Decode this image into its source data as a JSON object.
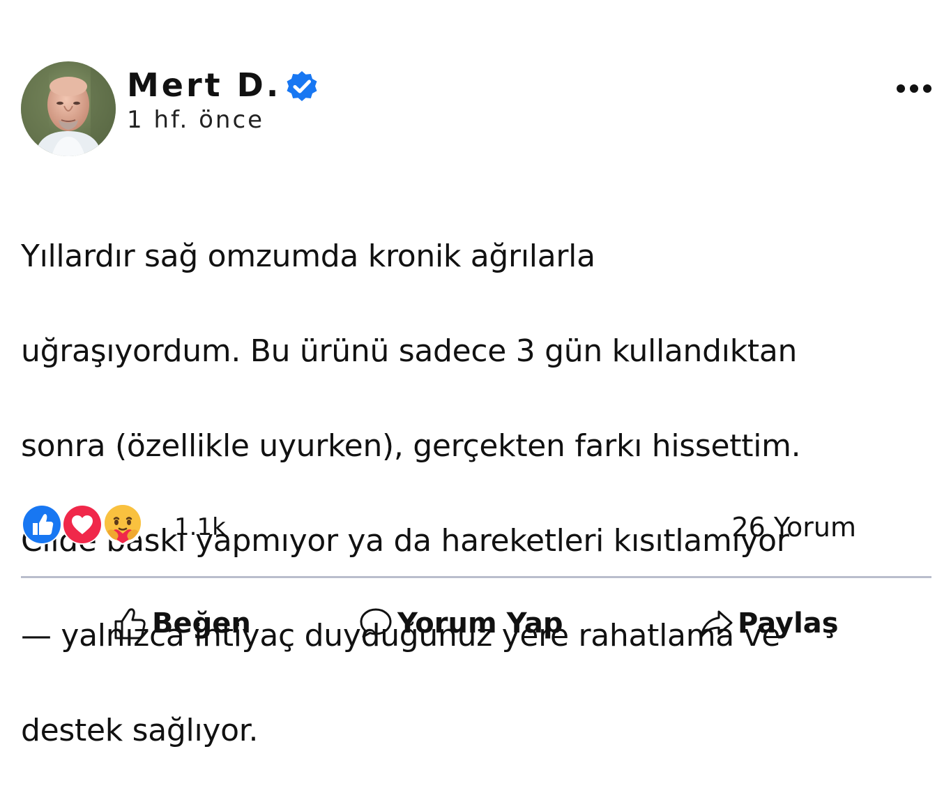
{
  "post": {
    "author": {
      "name": "Mert D.",
      "verified": true,
      "avatar_icon": "user-avatar-photo"
    },
    "timestamp": "1 hf. önce",
    "text_lines": [
      "Yıllardır sağ omzumda kronik ağrılarla",
      "uğraşıyordum. Bu ürünü sadece 3 gün kullandıktan",
      "sonra (özellikle uyurken), gerçekten farkı hissettim.",
      "Cilde baskı yapmıyor ya da hareketleri kısıtlamıyor",
      "— yalnızca ihtiyaç duyduğunuz yere rahatlama ve",
      "destek sağlıyor."
    ],
    "more_icon": "more-options-icon"
  },
  "reactions": {
    "icons": [
      "like-reaction-icon",
      "love-reaction-icon",
      "care-reaction-icon"
    ],
    "count": "1.1k",
    "comments": "26 Yorum"
  },
  "actions": {
    "like_label": "Beğen",
    "comment_label": "Yorum Yap",
    "share_label": "Paylaş"
  },
  "colors": {
    "verified_blue": "#1877f2",
    "like_blue": "#1877f2",
    "love_red": "#f0284a",
    "care_yellow": "#f7b125",
    "divider": "#b9bdcc",
    "text": "#111111"
  }
}
